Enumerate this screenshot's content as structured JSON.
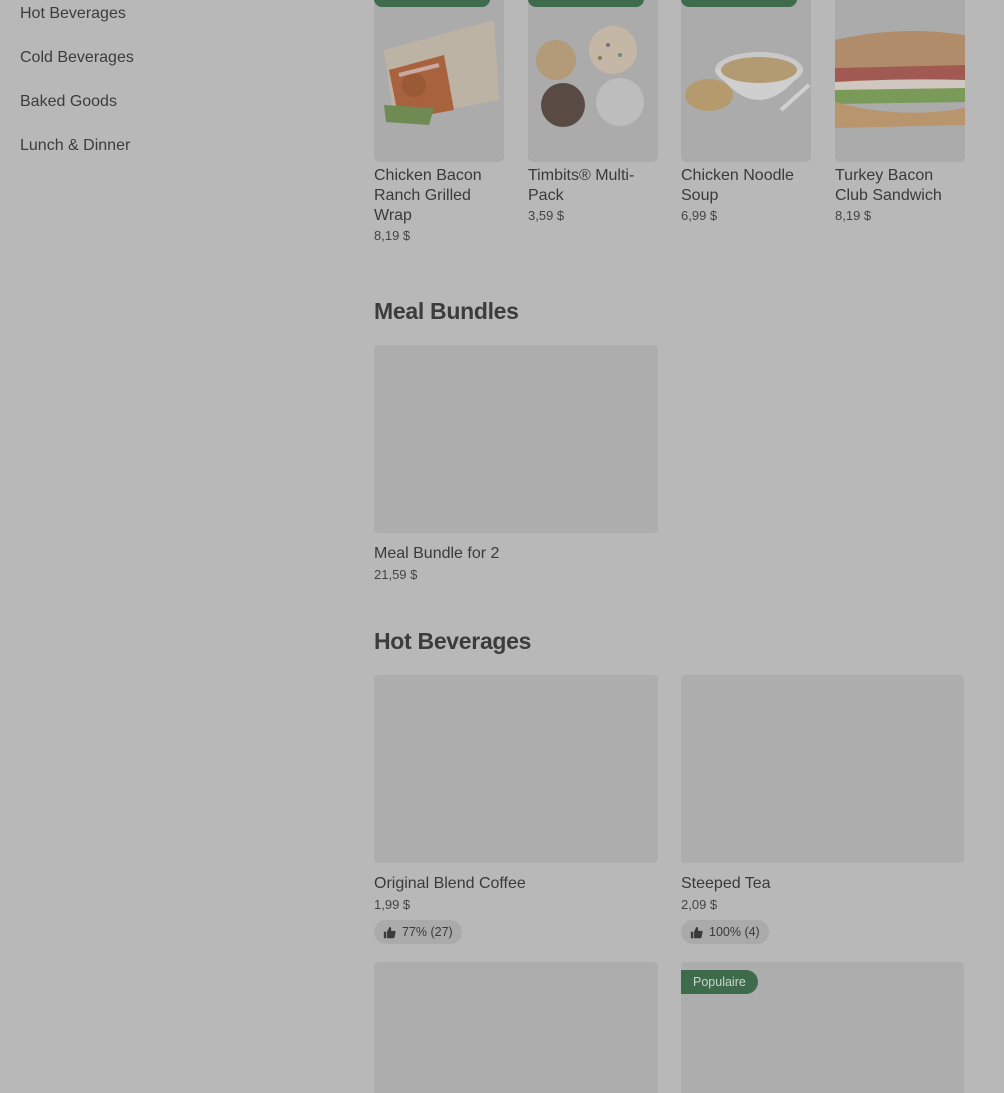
{
  "sidebar": {
    "items": [
      {
        "label": "Hot Beverages"
      },
      {
        "label": "Cold Beverages"
      },
      {
        "label": "Baked Goods"
      },
      {
        "label": "Lunch & Dinner"
      }
    ]
  },
  "carousel": {
    "items": [
      {
        "title": "Chicken Bacon Ranch Grilled Wrap",
        "price": "8,19 $"
      },
      {
        "title": "Timbits® Multi-Pack",
        "price": "3,59 $"
      },
      {
        "title": "Chicken Noodle Soup",
        "price": "6,99 $"
      },
      {
        "title": "Turkey Bacon Club Sandwich",
        "price": "8,19 $"
      }
    ]
  },
  "meal_bundles": {
    "title": "Meal Bundles",
    "items": [
      {
        "title": "Meal Bundle for 2",
        "price": "21,59 $"
      }
    ]
  },
  "hot_beverages": {
    "title": "Hot Beverages",
    "items": [
      {
        "title": "Original Blend Coffee",
        "price": "1,99 $",
        "rating": "77% (27)"
      },
      {
        "title": "Steeped Tea",
        "price": "2,09 $",
        "rating": "100% (4)"
      }
    ],
    "popular_badge": "Populaire"
  },
  "colors": {
    "overlay_bg": "#b8b8b8",
    "accent_green": "#3d6b4c"
  }
}
